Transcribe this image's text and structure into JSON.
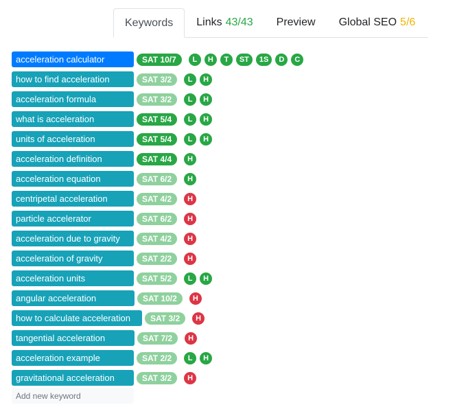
{
  "tabs": [
    {
      "label": "Keywords",
      "count": ""
    },
    {
      "label": "Links",
      "count": "43/43"
    },
    {
      "label": "Preview",
      "count": ""
    },
    {
      "label": "Global SEO",
      "count": "5/6"
    }
  ],
  "colors": {
    "keyword_bg": "#17a2b8",
    "keyword_selected_bg": "#007bff",
    "sat_dark": "#28a745",
    "sat_light": "#8fd19e",
    "badge_green": "#28a745",
    "badge_red": "#dc3545",
    "links_count": "#28a745",
    "seo_count": "#f0b400"
  },
  "keywords": [
    {
      "label": "acceleration calculator",
      "sat": "SAT 10/7",
      "sat_style": "dark",
      "badges": [
        {
          "t": "L",
          "c": "g"
        },
        {
          "t": "H",
          "c": "g"
        },
        {
          "t": "T",
          "c": "g"
        },
        {
          "t": "ST",
          "c": "g"
        },
        {
          "t": "1S",
          "c": "g"
        },
        {
          "t": "D",
          "c": "g"
        },
        {
          "t": "C",
          "c": "g"
        }
      ]
    },
    {
      "label": "how to find acceleration",
      "sat": "SAT 3/2",
      "sat_style": "light",
      "badges": [
        {
          "t": "L",
          "c": "g"
        },
        {
          "t": "H",
          "c": "g"
        }
      ]
    },
    {
      "label": "acceleration formula",
      "sat": "SAT 3/2",
      "sat_style": "light",
      "badges": [
        {
          "t": "L",
          "c": "g"
        },
        {
          "t": "H",
          "c": "g"
        }
      ]
    },
    {
      "label": "what is acceleration",
      "sat": "SAT 5/4",
      "sat_style": "dark",
      "badges": [
        {
          "t": "L",
          "c": "g"
        },
        {
          "t": "H",
          "c": "g"
        }
      ]
    },
    {
      "label": "units of acceleration",
      "sat": "SAT 5/4",
      "sat_style": "dark",
      "badges": [
        {
          "t": "L",
          "c": "g"
        },
        {
          "t": "H",
          "c": "g"
        }
      ]
    },
    {
      "label": "acceleration definition",
      "sat": "SAT 4/4",
      "sat_style": "dark",
      "badges": [
        {
          "t": "H",
          "c": "g"
        }
      ]
    },
    {
      "label": "acceleration equation",
      "sat": "SAT 6/2",
      "sat_style": "light",
      "badges": [
        {
          "t": "H",
          "c": "g"
        }
      ]
    },
    {
      "label": "centripetal acceleration",
      "sat": "SAT 4/2",
      "sat_style": "light",
      "badges": [
        {
          "t": "H",
          "c": "r"
        }
      ]
    },
    {
      "label": "particle accelerator",
      "sat": "SAT 6/2",
      "sat_style": "light",
      "badges": [
        {
          "t": "H",
          "c": "r"
        }
      ]
    },
    {
      "label": "acceleration due to gravity",
      "sat": "SAT 4/2",
      "sat_style": "light",
      "badges": [
        {
          "t": "H",
          "c": "r"
        }
      ]
    },
    {
      "label": "acceleration of gravity",
      "sat": "SAT 2/2",
      "sat_style": "light",
      "badges": [
        {
          "t": "H",
          "c": "r"
        }
      ]
    },
    {
      "label": "acceleration units",
      "sat": "SAT 5/2",
      "sat_style": "light",
      "badges": [
        {
          "t": "L",
          "c": "g"
        },
        {
          "t": "H",
          "c": "g"
        }
      ]
    },
    {
      "label": "angular acceleration",
      "sat": "SAT 10/2",
      "sat_style": "light",
      "badges": [
        {
          "t": "H",
          "c": "r"
        }
      ]
    },
    {
      "label": "how to calculate acceleration",
      "sat": "SAT 3/2",
      "sat_style": "light",
      "badges": [
        {
          "t": "H",
          "c": "r"
        }
      ]
    },
    {
      "label": "tangential acceleration",
      "sat": "SAT 7/2",
      "sat_style": "light",
      "badges": [
        {
          "t": "H",
          "c": "r"
        }
      ]
    },
    {
      "label": "acceleration example",
      "sat": "SAT 2/2",
      "sat_style": "light",
      "badges": [
        {
          "t": "L",
          "c": "g"
        },
        {
          "t": "H",
          "c": "g"
        }
      ]
    },
    {
      "label": "gravitational acceleration",
      "sat": "SAT 3/2",
      "sat_style": "light",
      "badges": [
        {
          "t": "H",
          "c": "r"
        }
      ]
    }
  ],
  "add_keyword": {
    "placeholder": "Add new keyword"
  }
}
